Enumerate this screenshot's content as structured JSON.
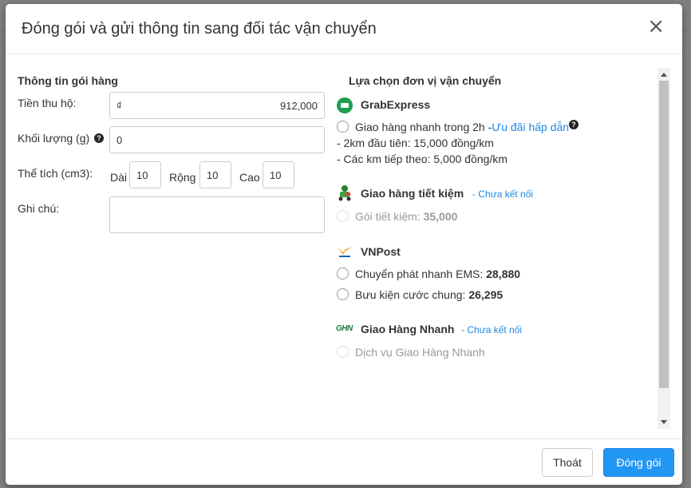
{
  "modal": {
    "title": "Đóng gói và gửi thông tin sang đối tác vận chuyển",
    "close_symbol": "×"
  },
  "package": {
    "section_title": "Thông tin gói hàng",
    "cod_label": "Tiền thu hộ:",
    "currency": "₫",
    "cod_value": "912,000",
    "weight_label": "Khối lượng (g)",
    "weight_value": "0",
    "volume_label": "Thể tích (cm3):",
    "length_label": "Dài",
    "length_value": "10",
    "width_label": "Rộng",
    "width_value": "10",
    "height_label": "Cao",
    "height_value": "10",
    "note_label": "Ghi chú:",
    "note_value": ""
  },
  "shipping": {
    "section_title": "Lựa chọn đơn vị vận chuyển",
    "grab": {
      "name": "GrabExpress",
      "option_text": "Giao hàng nhanh trong 2h -",
      "option_link": "Ưu đãi hấp dẫn",
      "detail1": "- 2km đầu tiên: 15,000 đồng/km",
      "detail2": "- Các km tiếp theo: 5,000 đồng/km"
    },
    "ght": {
      "name": "Giao hàng tiết kiệm",
      "status": "- Chưa kết nối",
      "option_text": "Gói tiết kiệm: ",
      "option_price": "35,000"
    },
    "vnpost": {
      "name": "VNPost",
      "option1_text": "Chuyển phát nhanh EMS: ",
      "option1_price": "28,880",
      "option2_text": "Bưu kiện cước chung: ",
      "option2_price": "26,295"
    },
    "ghn": {
      "logo_text": "GHN",
      "name": "Giao Hàng Nhanh",
      "status": "- Chưa kết nối",
      "option_text": "Dịch vụ Giao Hàng Nhanh"
    }
  },
  "footer": {
    "cancel_label": "Thoát",
    "submit_label": "Đóng gói"
  },
  "colors": {
    "primary": "#2196f3",
    "link": "#1e88e5",
    "grab_green": "#1c9e4e"
  }
}
